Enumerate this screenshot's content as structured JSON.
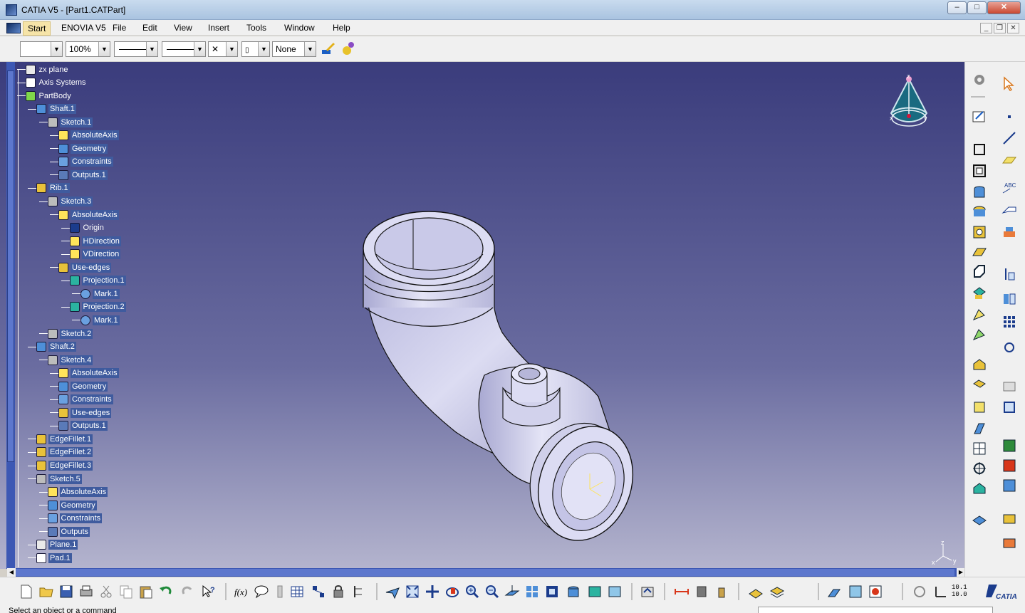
{
  "window": {
    "title": "CATIA V5 - [Part1.CATPart]",
    "minimize": "–",
    "maximize": "□",
    "close": "✕"
  },
  "menu": {
    "items": [
      "Start",
      "ENOVIA V5",
      "File",
      "Edit",
      "View",
      "Insert",
      "Tools",
      "Window",
      "Help"
    ]
  },
  "properties_toolbar": {
    "color_value": "",
    "zoom_value": "100%",
    "layer_value": "None"
  },
  "tree": {
    "nodes": [
      {
        "label": "zx plane",
        "icon": "plane-icon"
      },
      {
        "label": "Axis Systems",
        "icon": "axis-systems-icon"
      },
      {
        "label": "PartBody",
        "icon": "partbody-icon"
      },
      {
        "label": "Shaft.1",
        "icon": "shaft-icon"
      },
      {
        "label": "Sketch.1",
        "icon": "sketch-icon"
      },
      {
        "label": "AbsoluteAxis",
        "icon": "absolute-axis-icon"
      },
      {
        "label": "Geometry",
        "icon": "geometry-icon"
      },
      {
        "label": "Constraints",
        "icon": "constraints-icon"
      },
      {
        "label": "Outputs.1",
        "icon": "outputs-icon"
      },
      {
        "label": "Rib.1",
        "icon": "rib-icon"
      },
      {
        "label": "Sketch.3",
        "icon": "sketch-icon"
      },
      {
        "label": "AbsoluteAxis",
        "icon": "absolute-axis-icon"
      },
      {
        "label": "Origin",
        "icon": "origin-icon"
      },
      {
        "label": "HDirection",
        "icon": "hdirection-icon"
      },
      {
        "label": "VDirection",
        "icon": "vdirection-icon"
      },
      {
        "label": "Use-edges",
        "icon": "use-edges-icon"
      },
      {
        "label": "Projection.1",
        "icon": "projection-icon"
      },
      {
        "label": "Mark.1",
        "icon": "mark-icon"
      },
      {
        "label": "Projection.2",
        "icon": "projection-icon"
      },
      {
        "label": "Mark.1",
        "icon": "mark-icon"
      },
      {
        "label": "Sketch.2",
        "icon": "sketch-icon"
      },
      {
        "label": "Shaft.2",
        "icon": "shaft-icon"
      },
      {
        "label": "Sketch.4",
        "icon": "sketch-icon"
      },
      {
        "label": "AbsoluteAxis",
        "icon": "absolute-axis-icon"
      },
      {
        "label": "Geometry",
        "icon": "geometry-icon"
      },
      {
        "label": "Constraints",
        "icon": "constraints-icon"
      },
      {
        "label": "Use-edges",
        "icon": "use-edges-icon"
      },
      {
        "label": "Outputs.1",
        "icon": "outputs-icon"
      },
      {
        "label": "EdgeFillet.1",
        "icon": "edge-fillet-icon"
      },
      {
        "label": "EdgeFillet.2",
        "icon": "edge-fillet-icon"
      },
      {
        "label": "EdgeFillet.3",
        "icon": "edge-fillet-icon"
      },
      {
        "label": "Sketch.5",
        "icon": "sketch-icon"
      },
      {
        "label": "AbsoluteAxis",
        "icon": "absolute-axis-icon"
      },
      {
        "label": "Geometry",
        "icon": "geometry-icon"
      },
      {
        "label": "Constraints",
        "icon": "constraints-icon"
      },
      {
        "label": "Outputs",
        "icon": "outputs-icon"
      },
      {
        "label": "Plane.1",
        "icon": "plane-icon"
      },
      {
        "label": "Pad.1",
        "icon": "pad-icon"
      }
    ]
  },
  "compass": {
    "z_label": "z",
    "x_label": "x",
    "y_label": "y"
  },
  "viewport_axis": {
    "x": "x",
    "y": "y",
    "z": "z"
  },
  "bottom_toolbar": {
    "zoom_readout_top": "10.1",
    "zoom_readout_bottom": "10.0",
    "brand": "CATIA"
  },
  "status": {
    "message": "Select an object or a command",
    "command_input": ""
  },
  "colors": {
    "tree_text": "#ffffff",
    "viewport_top": "#3a3c7c",
    "viewport_bottom": "#b4b4ce",
    "tree_highlight": "#3f5b9e",
    "part_surface": "#c8c8e6"
  }
}
